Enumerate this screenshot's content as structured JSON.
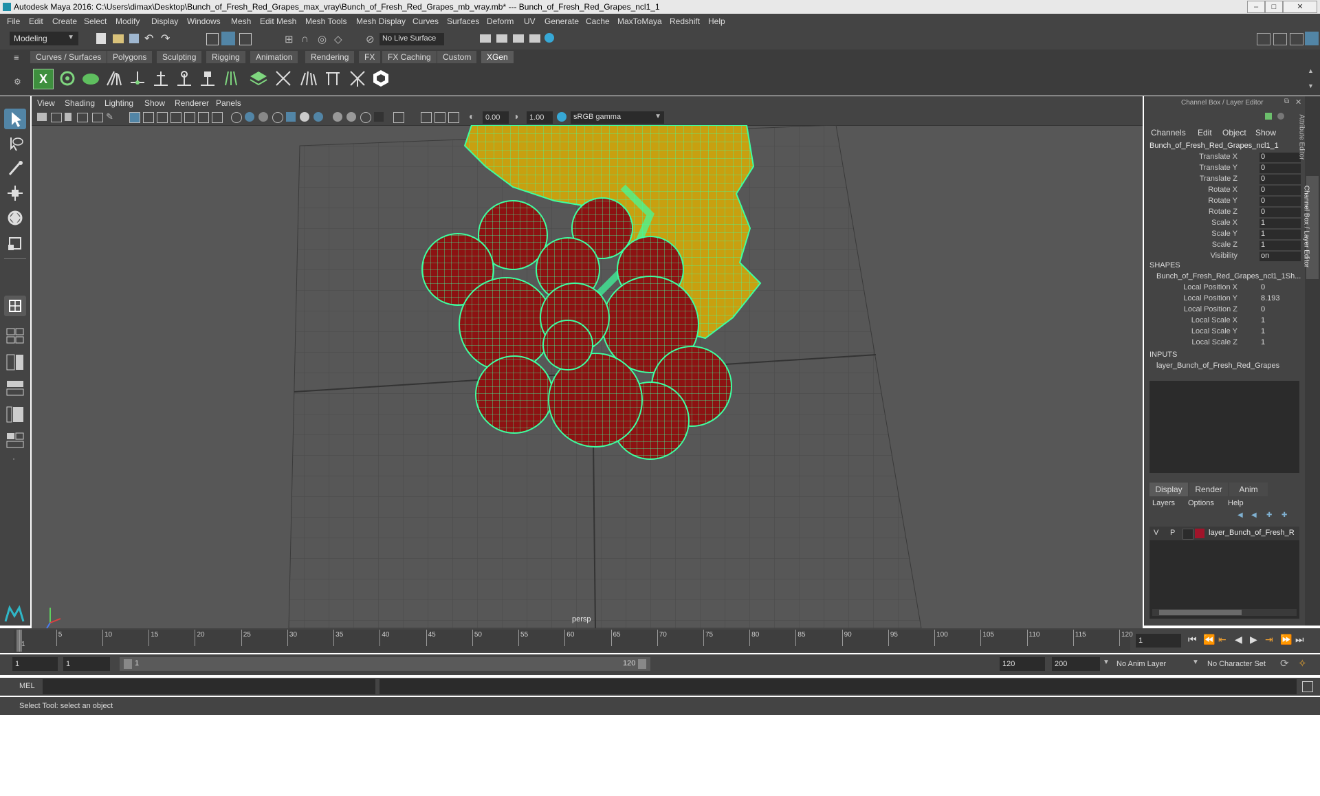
{
  "window": {
    "title": "Autodesk Maya 2016: C:\\Users\\dimax\\Desktop\\Bunch_of_Fresh_Red_Grapes_max_vray\\Bunch_of_Fresh_Red_Grapes_mb_vray.mb*   ---   Bunch_of_Fresh_Red_Grapes_ncl1_1"
  },
  "menu": [
    "File",
    "Edit",
    "Create",
    "Select",
    "Modify",
    "Display",
    "Windows",
    "Mesh",
    "Edit Mesh",
    "Mesh Tools",
    "Mesh Display",
    "Curves",
    "Surfaces",
    "Deform",
    "UV",
    "Generate",
    "Cache",
    "MaxToMaya",
    "Redshift",
    "Help"
  ],
  "toolbar": {
    "mode": "Modeling",
    "live_surface": "No Live Surface"
  },
  "shelf_tabs": [
    "Curves / Surfaces",
    "Polygons",
    "Sculpting",
    "Rigging",
    "Animation",
    "Rendering",
    "FX",
    "FX Caching",
    "Custom",
    "XGen"
  ],
  "shelf_active": "XGen",
  "viewport": {
    "menu": [
      "View",
      "Shading",
      "Lighting",
      "Show",
      "Renderer",
      "Panels"
    ],
    "exposure": "0.00",
    "gamma": "1.00",
    "color_space": "sRGB gamma",
    "camera": "persp"
  },
  "channel_box": {
    "header": "Channel Box / Layer Editor",
    "menu": [
      "Channels",
      "Edit",
      "Object",
      "Show"
    ],
    "object_name": "Bunch_of_Fresh_Red_Grapes_ncl1_1",
    "attributes": [
      {
        "label": "Translate X",
        "value": "0"
      },
      {
        "label": "Translate Y",
        "value": "0"
      },
      {
        "label": "Translate Z",
        "value": "0"
      },
      {
        "label": "Rotate X",
        "value": "0"
      },
      {
        "label": "Rotate Y",
        "value": "0"
      },
      {
        "label": "Rotate Z",
        "value": "0"
      },
      {
        "label": "Scale X",
        "value": "1"
      },
      {
        "label": "Scale Y",
        "value": "1"
      },
      {
        "label": "Scale Z",
        "value": "1"
      },
      {
        "label": "Visibility",
        "value": "on"
      }
    ],
    "shapes_title": "SHAPES",
    "shape_name": "Bunch_of_Fresh_Red_Grapes_ncl1_1Sh...",
    "shape_attributes": [
      {
        "label": "Local Position X",
        "value": "0"
      },
      {
        "label": "Local Position Y",
        "value": "8.193"
      },
      {
        "label": "Local Position Z",
        "value": "0"
      },
      {
        "label": "Local Scale X",
        "value": "1"
      },
      {
        "label": "Local Scale Y",
        "value": "1"
      },
      {
        "label": "Local Scale Z",
        "value": "1"
      }
    ],
    "inputs_title": "INPUTS",
    "input_name": "layer_Bunch_of_Fresh_Red_Grapes"
  },
  "layer_editor": {
    "tabs": [
      "Display",
      "Render",
      "Anim"
    ],
    "active_tab": "Display",
    "menu": [
      "Layers",
      "Options",
      "Help"
    ],
    "layer": {
      "v": "V",
      "p": "P",
      "name": "layer_Bunch_of_Fresh_R",
      "color": "#a0142a"
    }
  },
  "side_tabs": [
    "Attribute Editor",
    "Channel Box / Layer Editor"
  ],
  "timeline": {
    "ticks": [
      "1",
      "5",
      "10",
      "15",
      "20",
      "25",
      "30",
      "35",
      "40",
      "45",
      "50",
      "55",
      "60",
      "65",
      "70",
      "75",
      "80",
      "85",
      "90",
      "95",
      "100",
      "105",
      "110",
      "115",
      "120"
    ],
    "current_frame": "1"
  },
  "range": {
    "start": "1",
    "playback_start": "1",
    "slider_start": "1",
    "slider_end": "120",
    "playback_end": "120",
    "end": "200",
    "anim_layer": "No Anim Layer",
    "character_set": "No Character Set"
  },
  "command": {
    "label": "MEL"
  },
  "help_line": "Select Tool: select an object",
  "colors": {
    "wire": "#3dffa0",
    "grape": "#8c1212",
    "leaf": "#c8a010",
    "accent": "#5285a6"
  }
}
